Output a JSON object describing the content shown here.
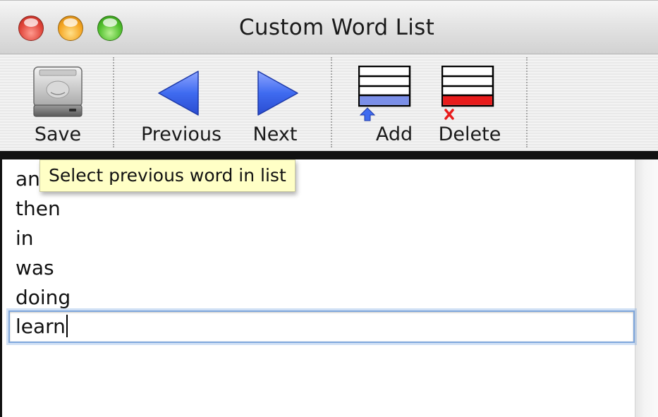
{
  "window": {
    "title": "Custom Word List"
  },
  "toolbar": {
    "save_label": "Save",
    "previous_label": "Previous",
    "next_label": "Next",
    "add_label": "Add",
    "delete_label": "Delete"
  },
  "tooltip": {
    "text": "Select previous word in list"
  },
  "words": {
    "items": [
      "an",
      "then",
      "in",
      "was",
      "doing"
    ],
    "editing": "learn"
  },
  "colors": {
    "arrow_blue": "#3f6bf0",
    "add_bar": "#7b8fe8",
    "delete_bar": "#e81c1c",
    "tooltip_bg": "#ffffc6",
    "focus_ring": "#7fa7dc"
  },
  "icons": {
    "save": "hard-drive-icon",
    "previous": "left-arrow-icon",
    "next": "right-arrow-icon",
    "add": "list-add-icon",
    "delete": "list-delete-icon"
  }
}
